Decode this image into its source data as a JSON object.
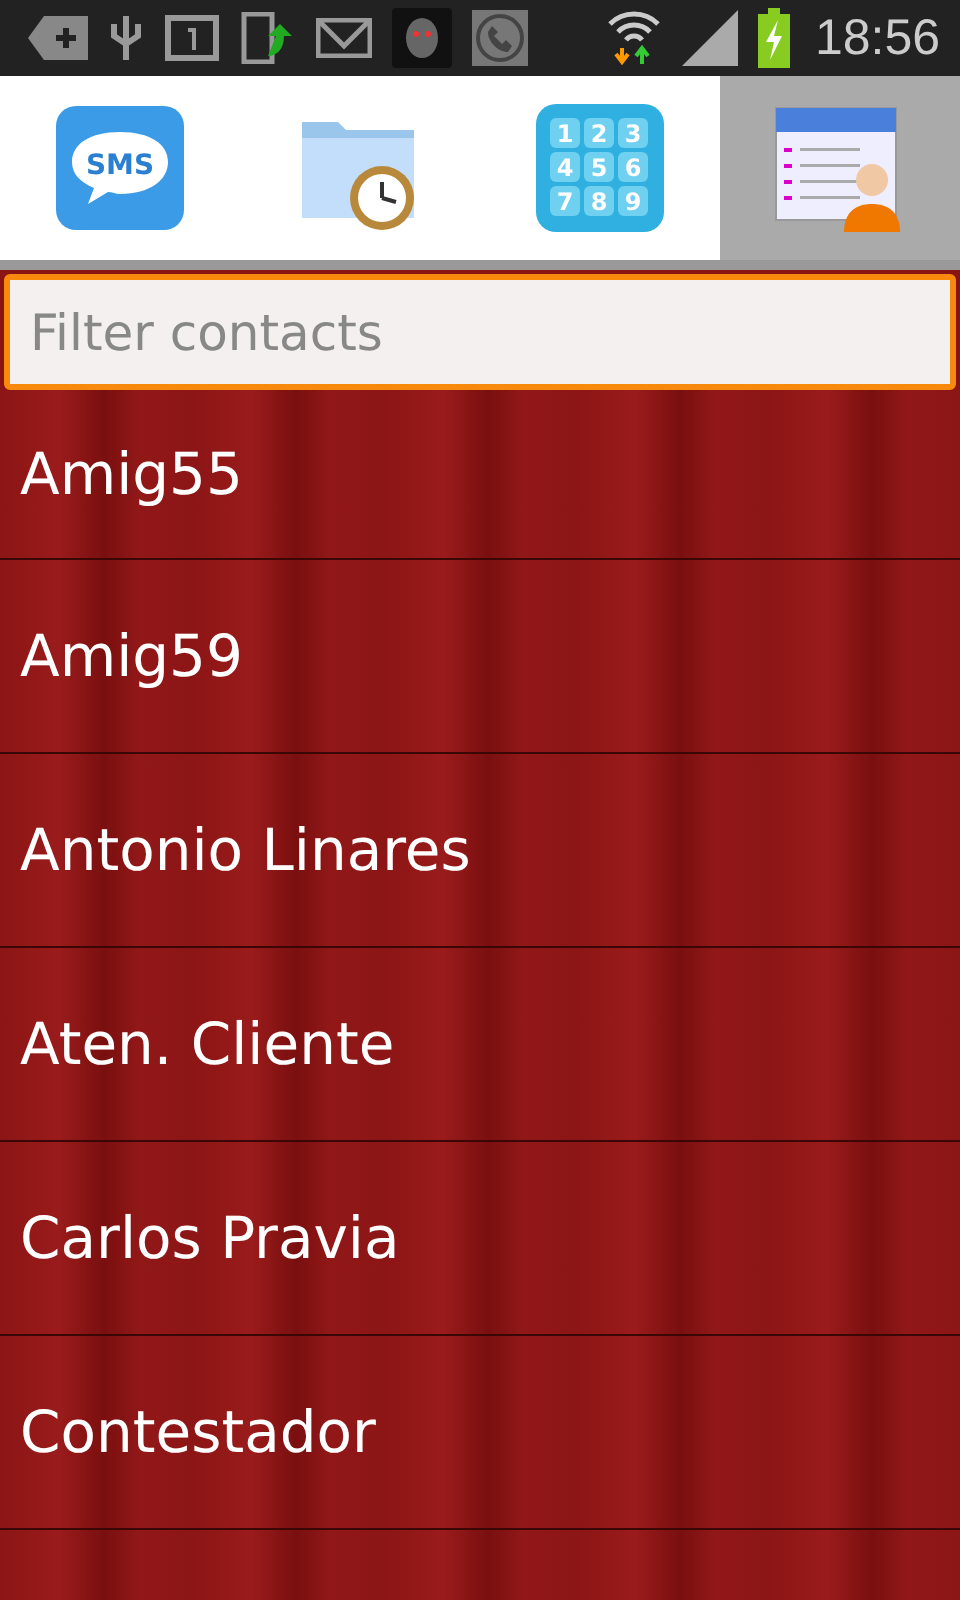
{
  "status_bar": {
    "time": "18:56"
  },
  "tabs": [
    {
      "kind": "sms",
      "label": "SMS",
      "selected": false
    },
    {
      "kind": "history",
      "selected": false
    },
    {
      "kind": "dialpad",
      "keys": [
        "1",
        "2",
        "3",
        "4",
        "5",
        "6",
        "7",
        "8",
        "9"
      ],
      "selected": false
    },
    {
      "kind": "contacts",
      "selected": true
    }
  ],
  "filter": {
    "placeholder": "Filter contacts"
  },
  "contacts": [
    {
      "name": "Amig55"
    },
    {
      "name": "Amig59"
    },
    {
      "name": "Antonio Linares"
    },
    {
      "name": "Aten. Cliente"
    },
    {
      "name": "Carlos Pravia"
    },
    {
      "name": "Contestador"
    }
  ]
}
